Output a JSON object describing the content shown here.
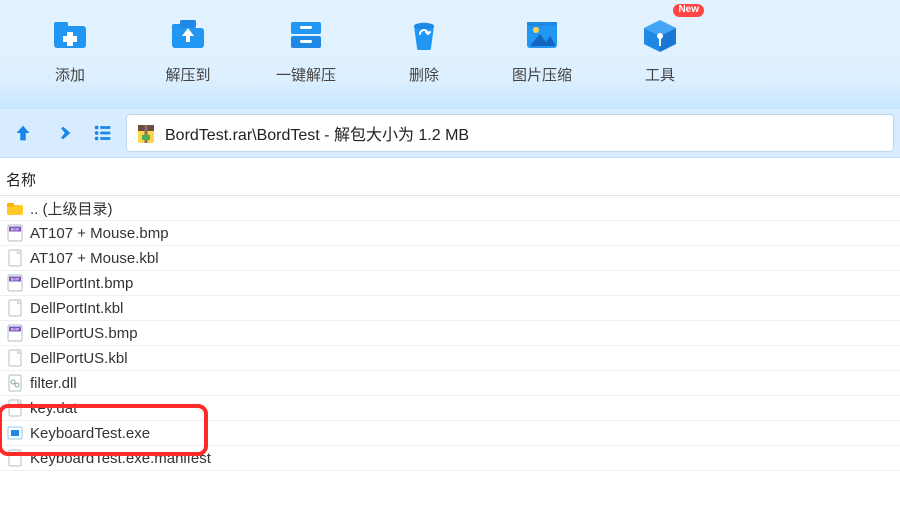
{
  "toolbar": {
    "items": [
      {
        "label": "添加",
        "icon": "add"
      },
      {
        "label": "解压到",
        "icon": "extract-to"
      },
      {
        "label": "一键解压",
        "icon": "one-click-extract"
      },
      {
        "label": "删除",
        "icon": "delete"
      },
      {
        "label": "图片压缩",
        "icon": "image-compress"
      },
      {
        "label": "工具",
        "icon": "tools",
        "badge": "New"
      }
    ]
  },
  "address": {
    "path": "BordTest.rar\\BordTest - 解包大小为 1.2 MB"
  },
  "list": {
    "header_name": "名称",
    "rows": [
      {
        "name": ".. (上级目录)",
        "icon": "folder"
      },
      {
        "name": "AT107 + Mouse.bmp",
        "icon": "bmp"
      },
      {
        "name": "AT107 + Mouse.kbl",
        "icon": "generic"
      },
      {
        "name": "DellPortInt.bmp",
        "icon": "bmp"
      },
      {
        "name": "DellPortInt.kbl",
        "icon": "generic"
      },
      {
        "name": "DellPortUS.bmp",
        "icon": "bmp"
      },
      {
        "name": "DellPortUS.kbl",
        "icon": "generic"
      },
      {
        "name": "filter.dll",
        "icon": "dll"
      },
      {
        "name": "key.dat",
        "icon": "generic"
      },
      {
        "name": "KeyboardTest.exe",
        "icon": "exe"
      },
      {
        "name": "KeyboardTest.exe.manifest",
        "icon": "generic"
      }
    ]
  },
  "highlight_row_index": 9
}
